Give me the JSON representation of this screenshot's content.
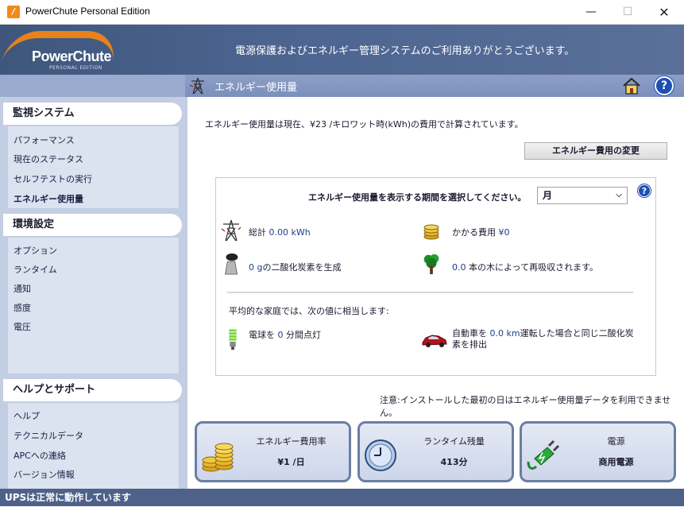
{
  "window": {
    "title": "PowerChute Personal Edition",
    "minimize": "—",
    "maximize": "☐",
    "close": "✕"
  },
  "header": {
    "logo_text": "PowerChute",
    "logo_sub": "PERSONAL EDITION",
    "welcome": "電源保護およびエネルギー管理システムのご利用ありがとうございます。"
  },
  "page": {
    "title": "エネルギー使用量"
  },
  "sidebar": {
    "sections": [
      {
        "title": "監視システム",
        "items": [
          "パフォーマンス",
          "現在のステータス",
          "セルフテストの実行",
          "エネルギー使用量"
        ]
      },
      {
        "title": "環境設定",
        "items": [
          "オプション",
          "ランタイム",
          "通知",
          "感度",
          "電圧"
        ]
      },
      {
        "title": "ヘルプとサポート",
        "items": [
          "ヘルプ",
          "テクニカルデータ",
          "APCへの連絡",
          "バージョン情報"
        ]
      }
    ]
  },
  "main": {
    "intro": "エネルギー使用量は現在、¥23 /キロワット時(kWh)の費用で計算されています。",
    "change_button": "エネルギー費用の変更",
    "period_label": "エネルギー使用量を表示する期間を選択してください。",
    "period_value": "月",
    "total_label": "総計",
    "total_value": "0.00 kWh",
    "cost_label": "かかる費用",
    "cost_value": "¥0",
    "co2_value": "0 g",
    "co2_text": "の二酸化炭素を生成",
    "trees_value": "0.0",
    "trees_text": " 本の木によって再吸収されます。",
    "avg_label": "平均的な家庭では、次の値に相当します:",
    "bulb_prefix": "電球を ",
    "bulb_value": "0",
    "bulb_suffix": " 分間点灯",
    "car_prefix": "自動車を ",
    "car_value": "0.0 km",
    "car_suffix_line1": "運転した場合と同じ二酸化炭",
    "car_suffix_line2": "素を排出",
    "note": "注意:インストールした最初の日はエネルギー使用量データを利用できません。"
  },
  "tiles": [
    {
      "label": "エネルギー費用率",
      "value": "¥1 /日",
      "icon": "coins-icon"
    },
    {
      "label": "ランタイム残量",
      "value": "413分",
      "icon": "clock-icon"
    },
    {
      "label": "電源",
      "value": "商用電源",
      "icon": "plug-icon"
    }
  ],
  "status": {
    "text": "UPSは正常に動作しています"
  },
  "colors": {
    "banner": "#4c6490",
    "sidebar": "#c3cde3",
    "status_bar": "#4e6189",
    "accent_orange": "#e8821a",
    "help_blue": "#1d4fb5"
  }
}
